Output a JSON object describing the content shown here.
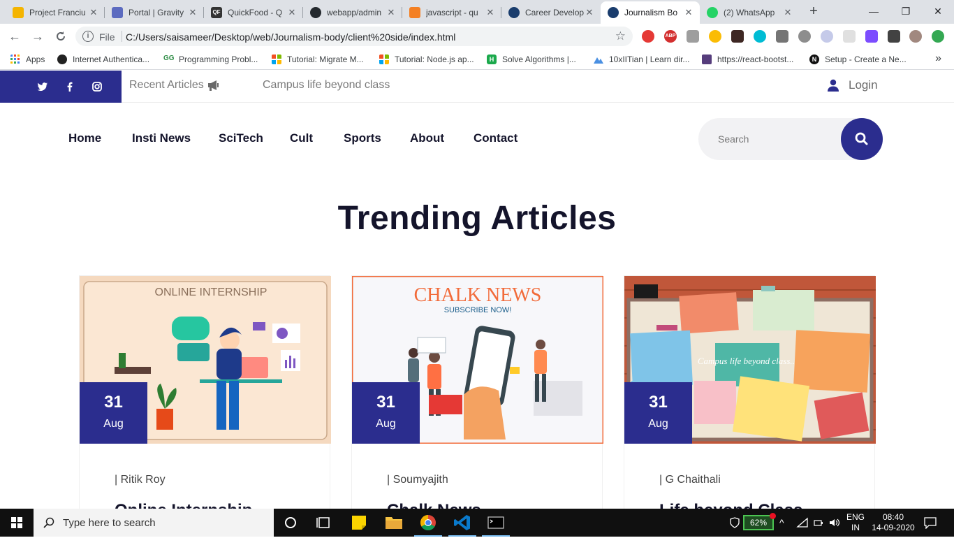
{
  "browser": {
    "tabs": [
      {
        "title": "Project Franciu",
        "favicon_color": "#f4b400",
        "active": false
      },
      {
        "title": "Portal | Gravity",
        "favicon_color": "#5c6bc0",
        "active": false
      },
      {
        "title": "QuickFood - Q",
        "favicon_color": "#333333",
        "active": false
      },
      {
        "title": "webapp/admin",
        "favicon_color": "#24292e",
        "active": false
      },
      {
        "title": "javascript - qu",
        "favicon_color": "#f48024",
        "active": false
      },
      {
        "title": "Career Develop",
        "favicon_color": "#1a3d6d",
        "active": false
      },
      {
        "title": "Journalism Bo",
        "favicon_color": "#1a3d6d",
        "active": true
      },
      {
        "title": "(2) WhatsApp",
        "favicon_color": "#25d366",
        "active": false
      }
    ],
    "new_tab_icon": "plus-icon",
    "address": {
      "scheme_label": "File",
      "url": "C:/Users/saisameer/Desktop/web/Journalism-body/client%20side/index.html"
    },
    "bookmarks": [
      {
        "label": "Apps",
        "icon_color": "#4285f4"
      },
      {
        "label": "Internet Authentica...",
        "icon_color": "#222222"
      },
      {
        "label": "Programming Probl...",
        "icon_color": "#2f8d46"
      },
      {
        "label": "Tutorial: Migrate M...",
        "icon_color": "#f25022"
      },
      {
        "label": "Tutorial: Node.js ap...",
        "icon_color": "#00a4ef"
      },
      {
        "label": "Solve Algorithms |...",
        "icon_color": "#1ba94c"
      },
      {
        "label": "10xIITian | Learn dir...",
        "icon_color": "#4a90e2"
      },
      {
        "label": "https://react-bootst...",
        "icon_color": "#563d7c"
      },
      {
        "label": "Setup - Create a Ne...",
        "icon_color": "#111111"
      }
    ]
  },
  "site": {
    "topbar": {
      "social": [
        "twitter-icon",
        "facebook-icon",
        "instagram-icon"
      ],
      "recent_label": "Recent Articles",
      "ticker": "Campus life beyond class",
      "login_label": "Login"
    },
    "nav": [
      "Home",
      "Insti News",
      "SciTech",
      "Cult",
      "Sports",
      "About",
      "Contact"
    ],
    "search": {
      "placeholder": "Search"
    },
    "brand_color": "#2b2d8e",
    "section_title": "Trending Articles",
    "articles": [
      {
        "day": "31",
        "month": "Aug",
        "author": "| Ritik Roy",
        "title": "Online Internship",
        "image_text": "ONLINE INTERNSHIP"
      },
      {
        "day": "31",
        "month": "Aug",
        "author": "| Soumyajith",
        "title": "Chalk News",
        "image_text": "CHALK NEWS",
        "image_subtext": "SUBSCRIBE NOW!"
      },
      {
        "day": "31",
        "month": "Aug",
        "author": "| G Chaithali",
        "title": "Life beyond Class",
        "image_text": "Campus life beyond class..."
      }
    ]
  },
  "taskbar": {
    "search_placeholder": "Type here to search",
    "battery": "62%",
    "lang_top": "ENG",
    "lang_bottom": "IN",
    "time": "08:40",
    "date": "14-09-2020"
  }
}
